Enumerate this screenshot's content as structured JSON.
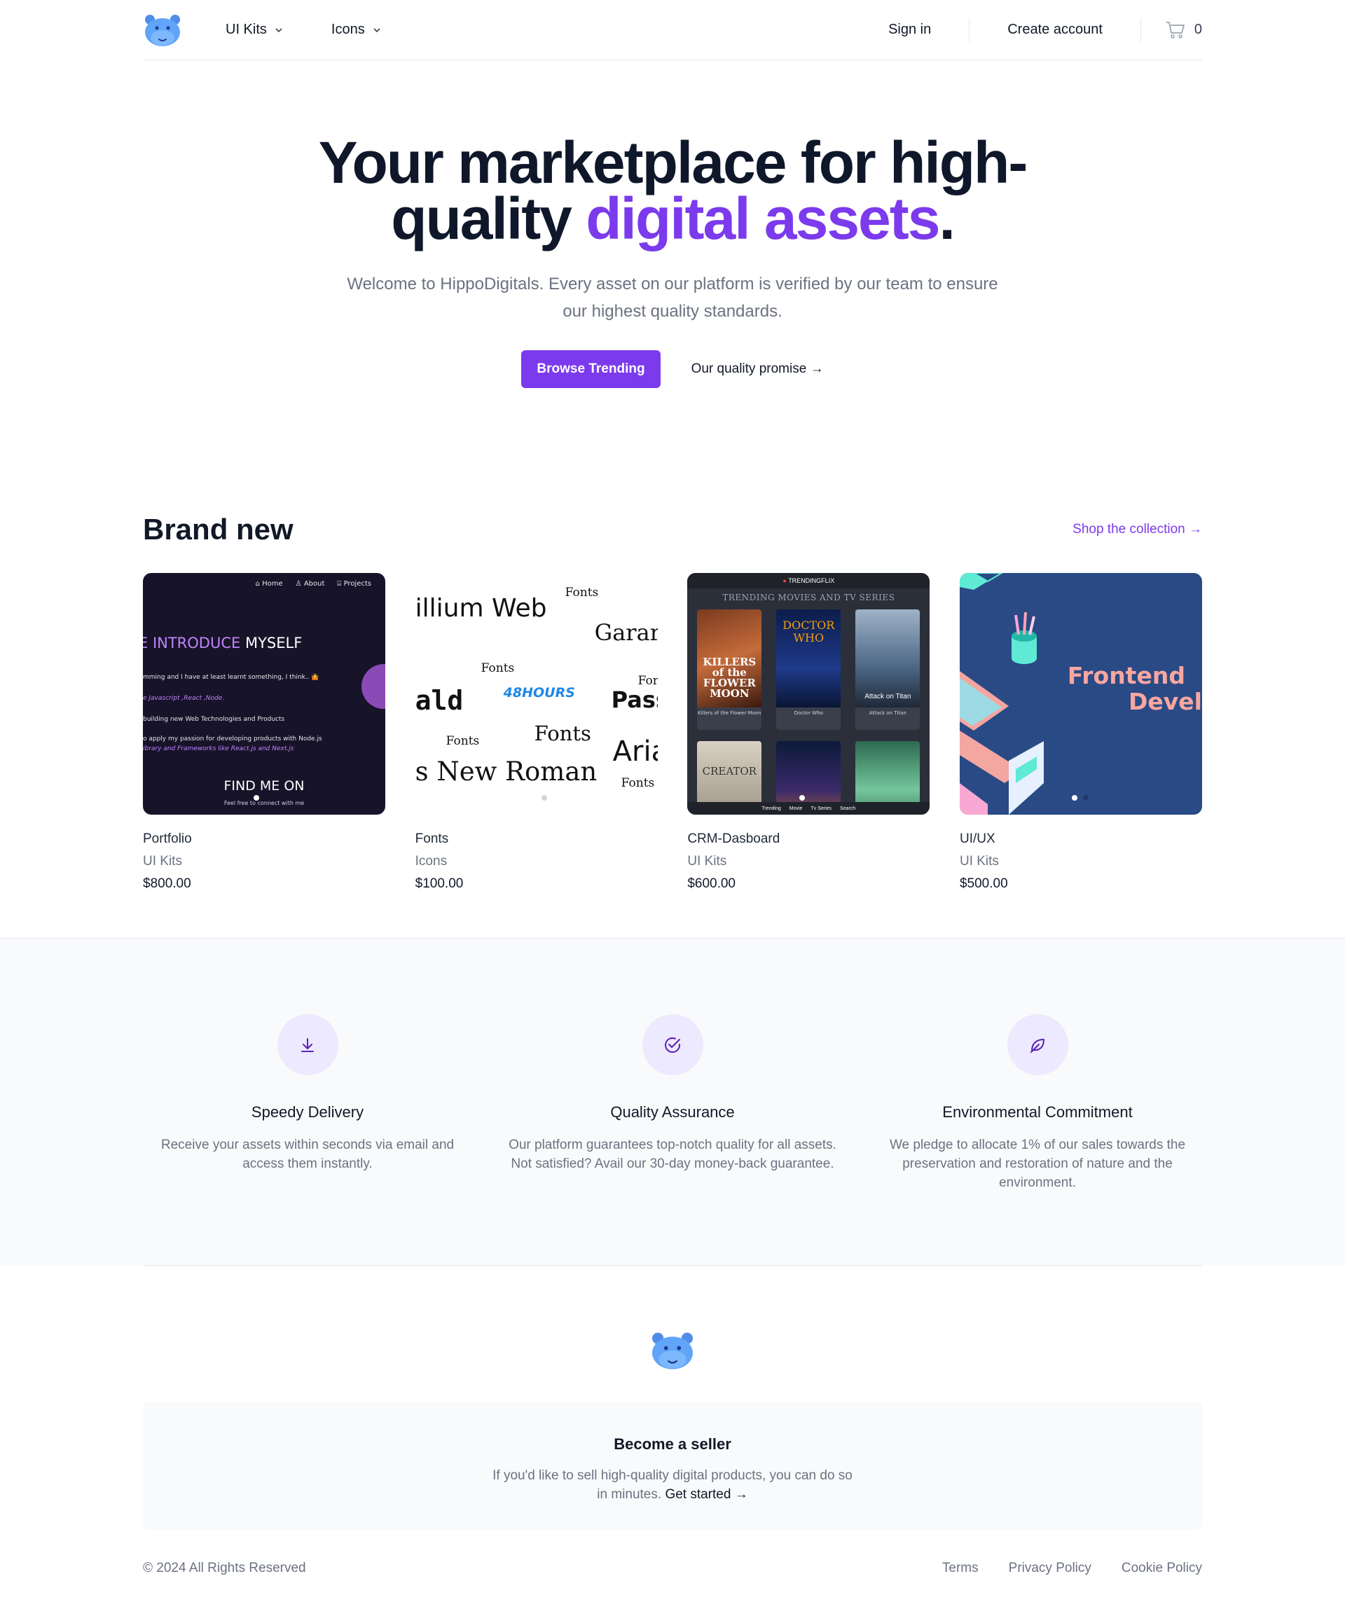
{
  "nav": {
    "menu": [
      {
        "label": "UI Kits"
      },
      {
        "label": "Icons"
      }
    ],
    "sign_in": "Sign in",
    "create_account": "Create account",
    "cart_count": "0"
  },
  "hero": {
    "title_part1": "Your marketplace for high-quality ",
    "title_accent": "digital assets",
    "title_end": ".",
    "subtitle": "Welcome to HippoDigitals. Every asset on our platform is verified by our team to ensure our highest quality standards.",
    "primary_cta": "Browse Trending",
    "secondary_cta": "Our quality promise →"
  },
  "brand": {
    "title": "Brand new",
    "shop_link": "Shop the collection →",
    "products": [
      {
        "name": "Portfolio",
        "category": "UI Kits",
        "price": "$800.00",
        "thumb": {
          "nav": [
            "⌂ Home",
            "♙ About",
            "⌸ Projects"
          ],
          "intro_a": "E INTRODUCE",
          "intro_b": " MYSELF",
          "lines": [
            "mming and I have at least learnt something, I think.. 🤷",
            "e Javascript ,React ,Node.",
            "building new  Web Technologies and Products",
            "o apply my passion for developing products with Node.js",
            "ibrary and Frameworks  like  React.js and Next.js"
          ],
          "find": "FIND ME ON",
          "fine": "Feel free to connect with me"
        }
      },
      {
        "name": "Fonts",
        "category": "Icons",
        "price": "$100.00",
        "thumb": {
          "words": [
            "illium Web",
            "Fonts",
            "Garar",
            "Fonts",
            "For",
            "ald",
            "48HOURS",
            "Pass",
            "Fonts",
            "Fonts",
            "Aria",
            "s New Roman",
            "Fonts"
          ]
        }
      },
      {
        "name": "CRM-Dasboard",
        "category": "UI Kits",
        "price": "$600.00",
        "thumb": {
          "brand": "TRENDINGFLIX",
          "heading": "TRENDING MOVIES AND TV SERIES",
          "posters": [
            {
              "title": "KILLERS of the FLOWER MOON",
              "caption": "Killers of the Flower Moon"
            },
            {
              "title": "DOCTOR WHO",
              "caption": "Doctor Who"
            },
            {
              "title": "Attack on Titan",
              "caption": "Attack on Titan"
            },
            {
              "title": "CREATOR",
              "caption": ""
            },
            {
              "title": "",
              "caption": ""
            },
            {
              "title": "",
              "caption": ""
            }
          ],
          "tabs": [
            "Trending",
            "Movie",
            "Tv Series",
            "Search"
          ]
        }
      },
      {
        "name": "UI/UX",
        "category": "UI Kits",
        "price": "$500.00",
        "thumb": {
          "line1": "Frontend",
          "line2": "Devel"
        }
      }
    ]
  },
  "features": [
    {
      "icon": "download-icon",
      "title": "Speedy Delivery",
      "text": "Receive your assets within seconds via email and access them instantly."
    },
    {
      "icon": "check-circle-icon",
      "title": "Quality Assurance",
      "text": "Our platform guarantees top-notch quality for all assets. Not satisfied? Avail our 30-day money-back guarantee."
    },
    {
      "icon": "leaf-icon",
      "title": "Environmental Commitment",
      "text": "We pledge to allocate 1% of our sales towards the preservation and restoration of nature and the environment."
    }
  ],
  "footer": {
    "seller_title": "Become a seller",
    "seller_text": "If you'd like to sell high-quality digital products, you can do so in minutes. ",
    "seller_link": "Get started →",
    "copyright": "© 2024 All Rights Reserved",
    "links": [
      "Terms",
      "Privacy Policy",
      "Cookie Policy"
    ]
  },
  "colors": {
    "accent": "#7c3aed",
    "icon_bg": "#ede9fe",
    "logo_blue": "#60a5fa"
  }
}
